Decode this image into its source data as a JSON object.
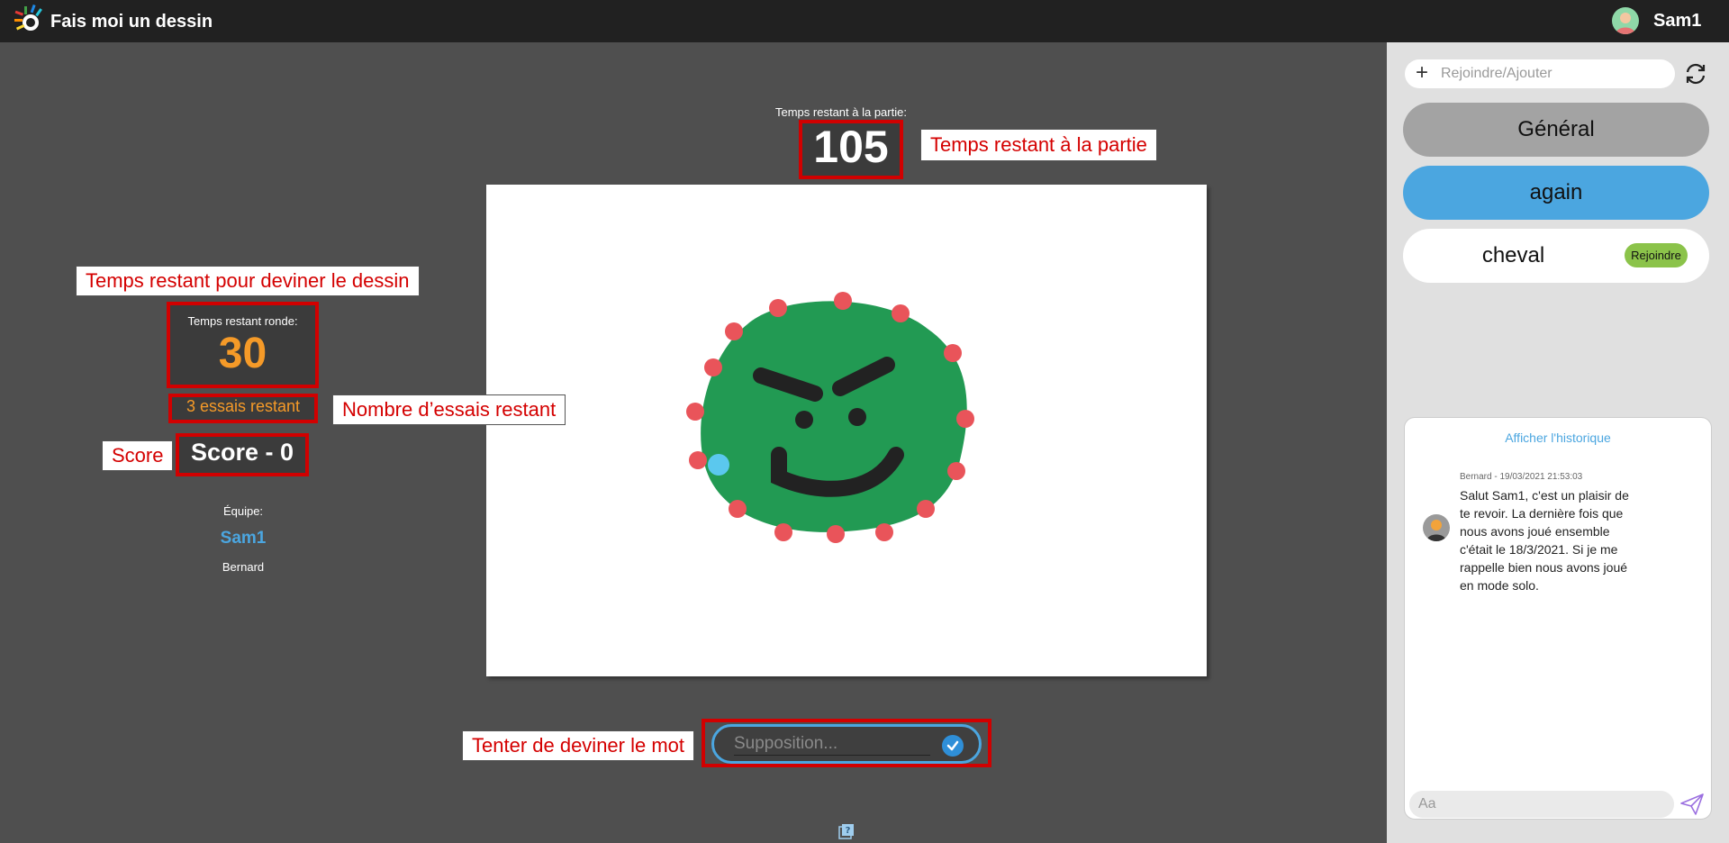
{
  "app": {
    "title": "Fais moi un dessin",
    "user_name": "Sam1"
  },
  "game": {
    "game_time_label": "Temps restant à la partie:",
    "game_time_value": "105",
    "round_time_label": "Temps restant ronde:",
    "round_time_value": "30",
    "tries_text": "3 essais restant",
    "score_text": "Score - 0",
    "team_label": "Équipe:",
    "team_members": [
      "Sam1",
      "Bernard"
    ],
    "guess_placeholder": "Supposition..."
  },
  "annotations": {
    "game_time": "Temps restant à la partie",
    "round_time": "Temps restant pour deviner le dessin",
    "tries": "Nombre d’essais restant",
    "score": "Score",
    "guess": "Tenter de deviner le mot"
  },
  "sidebar": {
    "join_placeholder": "Rejoindre/Ajouter",
    "channels": [
      {
        "name": "Général"
      },
      {
        "name": "again"
      },
      {
        "name": "cheval",
        "action": "Rejoindre"
      }
    ],
    "chat": {
      "history_link": "Afficher l'historique",
      "message": {
        "meta": "Bernard - 19/03/2021 21:53:03",
        "text": "Salut Sam1, c'est un plaisir de te revoir. La dernière fois que nous avons joué ensemble c'était le 18/3/2021. Si je me rappelle bien nous avons joué en mode solo."
      },
      "input_placeholder": "Aa"
    }
  },
  "colors": {
    "topbar": "#212121",
    "main_bg": "#4f4f4f",
    "accent_blue": "#4ba6e0",
    "accent_orange": "#f59a28",
    "annotation_red": "#d10000",
    "drawing_green": "#229a53",
    "drawing_dots": "#e9545a"
  }
}
